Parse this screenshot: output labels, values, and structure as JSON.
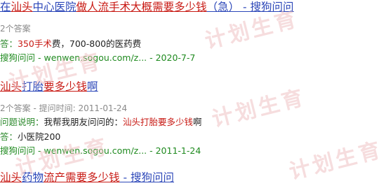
{
  "watermark": {
    "text": "计划生育",
    "color": "#f0c2c4"
  },
  "results": [
    {
      "title_segments": [
        {
          "text": "在",
          "color": "blue"
        },
        {
          "text": "汕头",
          "color": "red"
        },
        {
          "text": "中心医院",
          "color": "blue"
        },
        {
          "text": "做人流手术大概",
          "color": "red"
        },
        {
          "text": "需要多少钱",
          "color": "red"
        },
        {
          "text": "（急） - 搜狗问问",
          "color": "blue"
        }
      ],
      "meta": "2个答案",
      "snippet_label": "答：",
      "snippet_highlight": "350手术",
      "snippet_rest": "费，700-800的医药费",
      "url_site": "搜狗问问",
      "url_path": " - wenwen.sogou.com/z... - 2020-7-7"
    },
    {
      "title_segments": [
        {
          "text": "汕头",
          "color": "red"
        },
        {
          "text": "打胎",
          "color": "blue"
        },
        {
          "text": "要多少钱",
          "color": "red"
        },
        {
          "text": "啊",
          "color": "blue"
        }
      ],
      "meta": "2个答案 - 提问时间: 2011-01-24",
      "question_label": "问题说明：",
      "question_text_before": "我帮我朋友问问的：",
      "question_highlight": "汕头打胎要多少钱",
      "question_text_after": "啊",
      "snippet_label": "答：",
      "snippet_rest": "小医院200",
      "url_site": "搜狗问问",
      "url_path": " - wenwen.sogou.com/z... - 2011-1-24"
    },
    {
      "title_segments": [
        {
          "text": "汕头",
          "color": "red"
        },
        {
          "text": "药物",
          "color": "blue"
        },
        {
          "text": "流产需要多少钱",
          "color": "red"
        },
        {
          "text": " - 搜狗问问",
          "color": "blue"
        }
      ]
    }
  ]
}
